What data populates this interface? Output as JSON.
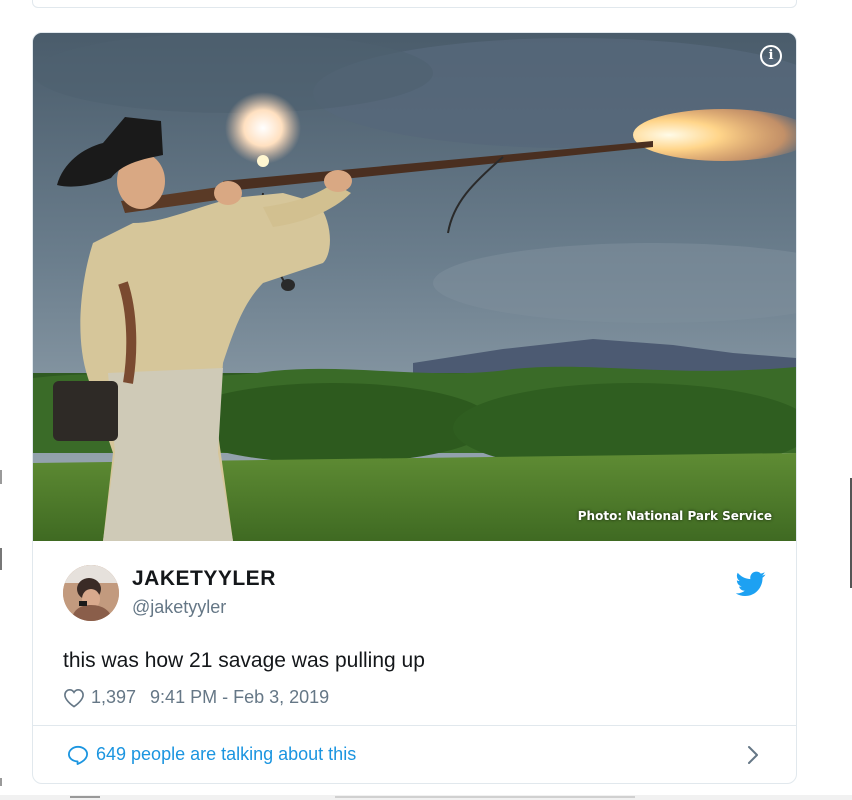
{
  "photo": {
    "credit": "Photo: National Park Service",
    "info_icon": "info-icon",
    "info_glyph": "i"
  },
  "tweet": {
    "display_name": "JAKETYYLER",
    "handle": "@jaketyyler",
    "text": "this was how 21 savage was pulling up",
    "likes": "1,397",
    "timestamp": "9:41 PM - Feb 3, 2019"
  },
  "footer": {
    "talking": "649 people are talking about this"
  },
  "colors": {
    "twitter_blue": "#1da1f2",
    "link_blue": "#1b95e0",
    "meta_gray": "#657786",
    "text_dark": "#14171a",
    "border": "#e1e8ed"
  },
  "icons": {
    "bird": "twitter-bird-icon",
    "heart": "heart-icon",
    "bubble": "speech-bubble-icon",
    "chevron": "chevron-right-icon"
  }
}
